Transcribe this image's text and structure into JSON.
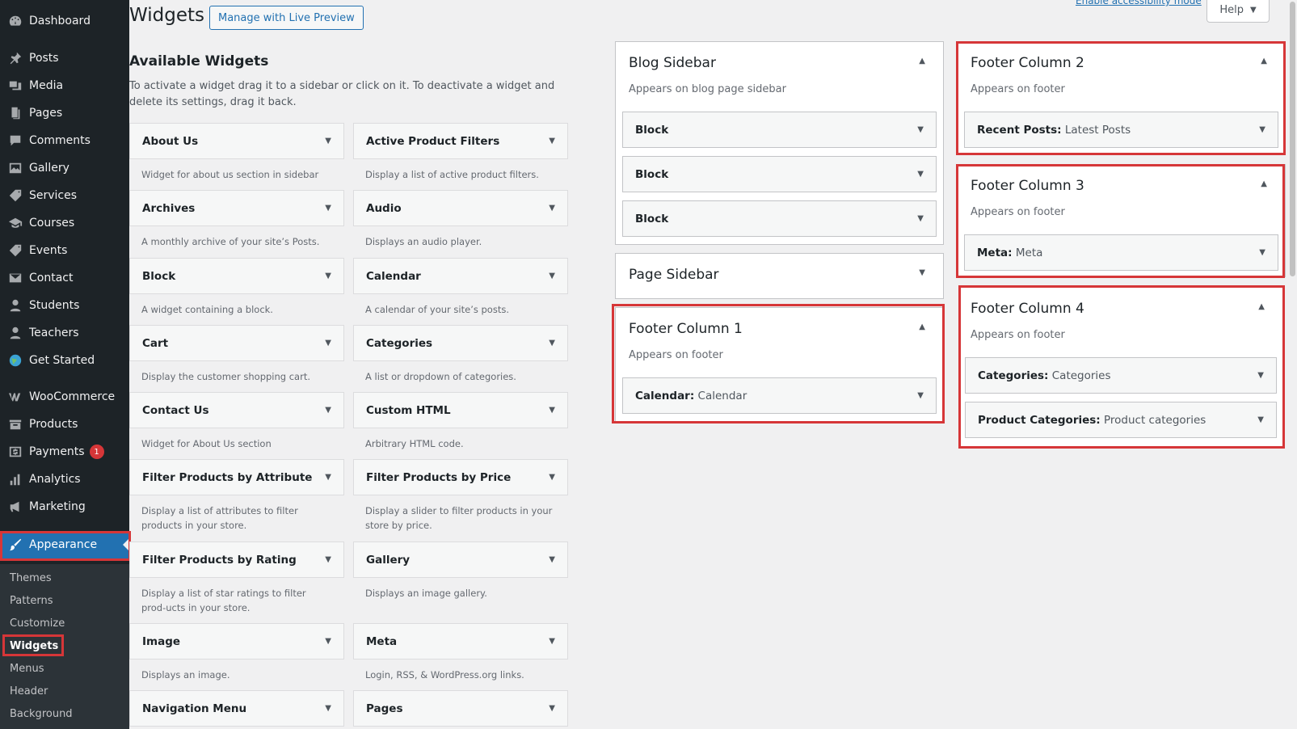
{
  "sidebar": {
    "items": [
      {
        "label": "Dashboard",
        "icon": "dashboard-icon"
      },
      {
        "label": "Posts",
        "icon": "pin-icon"
      },
      {
        "label": "Media",
        "icon": "media-icon"
      },
      {
        "label": "Pages",
        "icon": "pages-icon"
      },
      {
        "label": "Comments",
        "icon": "comments-icon"
      },
      {
        "label": "Gallery",
        "icon": "gallery-icon"
      },
      {
        "label": "Services",
        "icon": "tag-icon"
      },
      {
        "label": "Courses",
        "icon": "courses-icon"
      },
      {
        "label": "Events",
        "icon": "tag-icon"
      },
      {
        "label": "Contact",
        "icon": "email-icon"
      },
      {
        "label": "Students",
        "icon": "user-icon"
      },
      {
        "label": "Teachers",
        "icon": "user-icon"
      },
      {
        "label": "Get Started",
        "icon": "globe-icon"
      },
      {
        "label": "WooCommerce",
        "icon": "woo-icon"
      },
      {
        "label": "Products",
        "icon": "products-icon"
      },
      {
        "label": "Payments",
        "icon": "payments-icon",
        "badge": "1"
      },
      {
        "label": "Analytics",
        "icon": "analytics-icon"
      },
      {
        "label": "Marketing",
        "icon": "megaphone-icon"
      },
      {
        "label": "Appearance",
        "icon": "brush-icon",
        "current": true
      }
    ],
    "submenu": [
      "Themes",
      "Patterns",
      "Customize",
      "Widgets",
      "Menus",
      "Header",
      "Background"
    ],
    "submenu_current": "Widgets"
  },
  "header": {
    "title": "Widgets",
    "live_preview_button": "Manage with Live Preview",
    "accessibility_link": "Enable accessibility mode",
    "help_button": "Help"
  },
  "available": {
    "title": "Available Widgets",
    "description": "To activate a widget drag it to a sidebar or click on it. To deactivate a widget and delete its settings, drag it back.",
    "widgets": [
      {
        "name": "About Us",
        "desc": "Widget for about us section in sidebar"
      },
      {
        "name": "Active Product Filters",
        "desc": "Display a list of active product filters."
      },
      {
        "name": "Archives",
        "desc": "A monthly archive of your site’s Posts."
      },
      {
        "name": "Audio",
        "desc": "Displays an audio player."
      },
      {
        "name": "Block",
        "desc": "A widget containing a block."
      },
      {
        "name": "Calendar",
        "desc": "A calendar of your site’s posts."
      },
      {
        "name": "Cart",
        "desc": "Display the customer shopping cart."
      },
      {
        "name": "Categories",
        "desc": "A list or dropdown of categories."
      },
      {
        "name": "Contact Us",
        "desc": "Widget for About Us section"
      },
      {
        "name": "Custom HTML",
        "desc": "Arbitrary HTML code."
      },
      {
        "name": "Filter Products by Attribute",
        "desc": "Display a list of attributes to filter products in your store."
      },
      {
        "name": "Filter Products by Price",
        "desc": "Display a slider to filter products in your store by price."
      },
      {
        "name": "Filter Products by Rating",
        "desc": "Display a list of star ratings to filter prod-ucts in your store."
      },
      {
        "name": "Gallery",
        "desc": "Displays an image gallery."
      },
      {
        "name": "Image",
        "desc": "Displays an image."
      },
      {
        "name": "Meta",
        "desc": "Login, RSS, & WordPress.org links."
      },
      {
        "name": "Navigation Menu",
        "desc": ""
      },
      {
        "name": "Pages",
        "desc": ""
      }
    ]
  },
  "areas": {
    "blog_sidebar": {
      "title": "Blog Sidebar",
      "desc": "Appears on blog page sidebar",
      "widgets": [
        {
          "name": "Block",
          "instance": ""
        },
        {
          "name": "Block",
          "instance": ""
        },
        {
          "name": "Block",
          "instance": ""
        }
      ]
    },
    "page_sidebar": {
      "title": "Page Sidebar"
    },
    "footer_1": {
      "title": "Footer Column 1",
      "desc": "Appears on footer",
      "widgets": [
        {
          "name": "Calendar:",
          "instance": "Calendar"
        }
      ]
    },
    "footer_2": {
      "title": "Footer Column 2",
      "desc": "Appears on footer",
      "widgets": [
        {
          "name": "Recent Posts:",
          "instance": "Latest Posts"
        }
      ]
    },
    "footer_3": {
      "title": "Footer Column 3",
      "desc": "Appears on footer",
      "widgets": [
        {
          "name": "Meta:",
          "instance": "Meta"
        }
      ]
    },
    "footer_4": {
      "title": "Footer Column 4",
      "desc": "Appears on footer",
      "widgets": [
        {
          "name": "Categories:",
          "instance": "Categories"
        },
        {
          "name": "Product Categories:",
          "instance": "Product categories"
        }
      ]
    }
  },
  "colors": {
    "highlight": "#d63638",
    "accent": "#2271b1",
    "menu_bg": "#1d2327"
  }
}
